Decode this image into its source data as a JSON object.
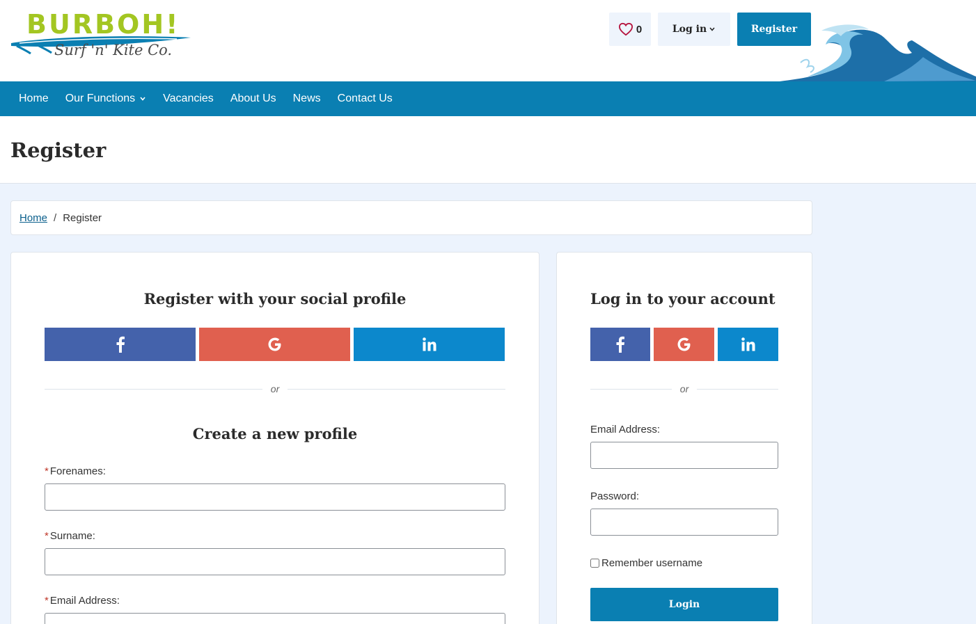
{
  "brand": {
    "name": "BURBOH!",
    "tagline": "Surf 'n' Kite Co."
  },
  "header": {
    "favourites_count": "0",
    "login_label": "Log in",
    "register_label": "Register"
  },
  "nav": {
    "items": [
      {
        "label": "Home"
      },
      {
        "label": "Our Functions"
      },
      {
        "label": "Vacancies"
      },
      {
        "label": "About Us"
      },
      {
        "label": "News"
      },
      {
        "label": "Contact Us"
      }
    ]
  },
  "page": {
    "title": "Register"
  },
  "breadcrumb": {
    "home": "Home",
    "separator": "/",
    "current": "Register"
  },
  "register_panel": {
    "social_heading": "Register with your social profile",
    "or_text": "or",
    "create_heading": "Create a new profile",
    "required_marker": "*",
    "fields": {
      "forenames": {
        "label": "Forenames:",
        "value": ""
      },
      "surname": {
        "label": "Surname:",
        "value": ""
      },
      "email": {
        "label": "Email Address:",
        "value": ""
      }
    }
  },
  "login_panel": {
    "heading": "Log in to your account",
    "or_text": "or",
    "email_label": "Email Address:",
    "email_value": "",
    "password_label": "Password:",
    "password_value": "",
    "remember_label": "Remember username",
    "remember_checked": false,
    "submit_label": "Login"
  },
  "colors": {
    "brand_blue": "#0a7fb2",
    "brand_green": "#a3c622",
    "facebook": "#4462ab",
    "google": "#e0604f",
    "linkedin": "#0c88cc",
    "page_bg": "#ecf3fd"
  },
  "icons": {
    "favourites": "heart-icon",
    "dropdown": "chevron-down-icon",
    "facebook": "facebook-icon",
    "google": "google-icon",
    "linkedin": "linkedin-icon"
  }
}
